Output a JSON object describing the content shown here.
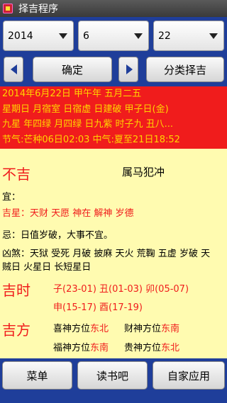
{
  "app": {
    "title": "择吉程序"
  },
  "selectors": {
    "year": "2014",
    "month": "6",
    "day": "22"
  },
  "buttons": {
    "confirm": "确定",
    "classify": "分类择吉"
  },
  "date_info": {
    "line1": "2014年6月22日 甲午年 五月二五",
    "line2": "星期日 月宿室 日宿虚 日建破 甲子日(金)",
    "line3": "九星   年四绿 月四绿 日九紫 时子九 丑八...",
    "line4": "节气:芒种06日02:03 中气:夏至21日18:52"
  },
  "main": {
    "verdict": "不吉",
    "clash": "属马犯冲",
    "yi_label": "宜：",
    "jishen_label": "吉星：",
    "jishen_value": "天财 天愿 神在 解神 岁德",
    "ji_label": "忌：",
    "ji_value": "日值岁破，大事不宜。",
    "xiongsha_label": "凶煞：",
    "xiongsha_line1": "天狱 受死 月破 披麻 天火 荒鞠 五虚 岁破 天",
    "xiongsha_line2": "贼日 火星日 长短星日"
  },
  "jishi": {
    "label": "吉时",
    "line1": "子(23-01) 丑(01-03) 卯(05-07)",
    "line2": "申(15-17) 酉(17-19)"
  },
  "jifang": {
    "label": "吉方",
    "xi_label": "喜神方位",
    "xi_value": "东北",
    "cai_label": "财神方位",
    "cai_value": "东南",
    "fu_label": "福神方位",
    "fu_value": "东南",
    "gui_label": "贵神方位",
    "gui_value": "东北"
  },
  "bottom_nav": {
    "menu": "菜单",
    "reading": "读书吧",
    "myapps": "自家应用"
  },
  "colors": {
    "blue_panel": "#1f3e9a",
    "red": "#f01c1c",
    "yellow_text": "#ffd400",
    "content_bg": "#fffbb0"
  }
}
